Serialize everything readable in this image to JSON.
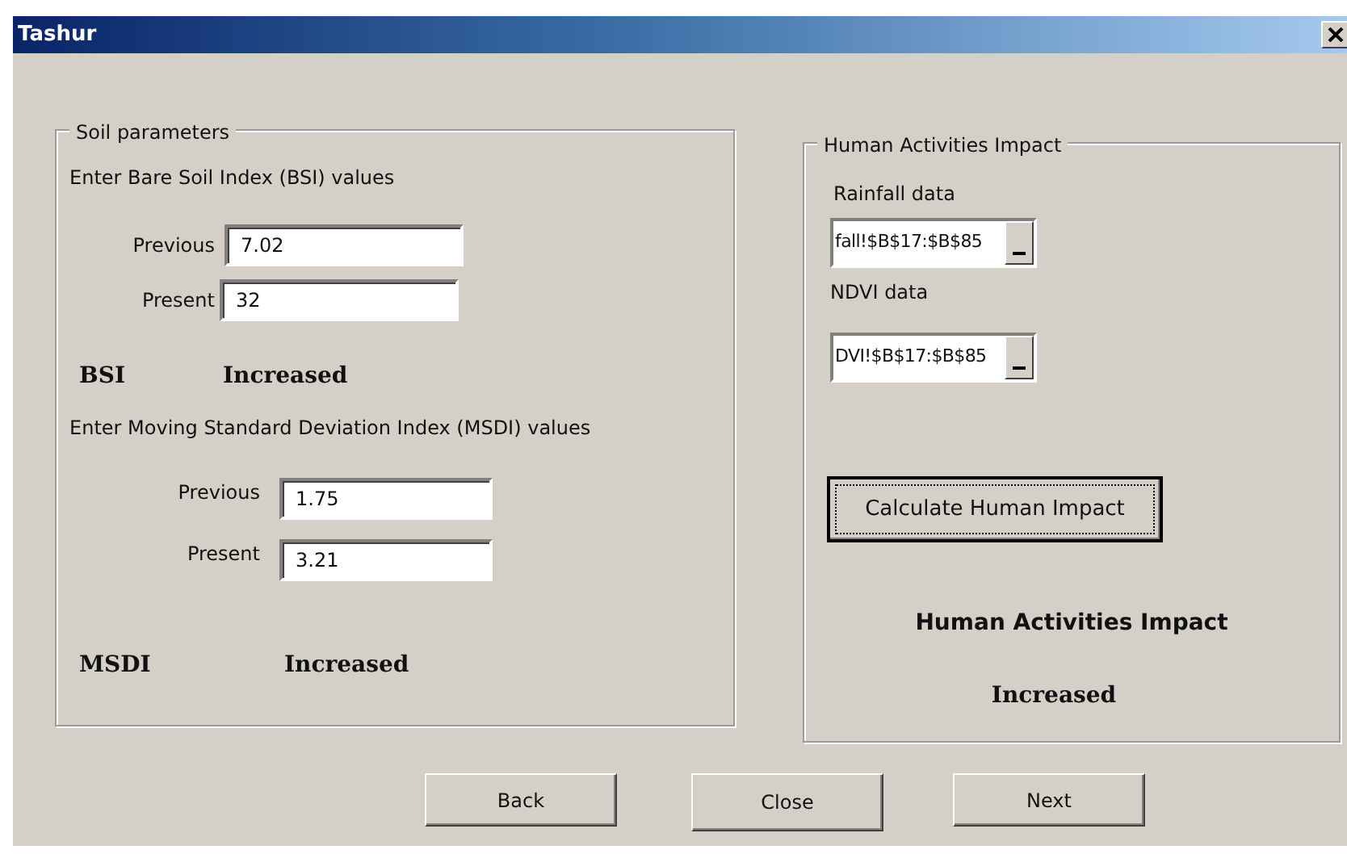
{
  "window": {
    "title": "Tashur"
  },
  "soil": {
    "legend": "Soil parameters",
    "groups": [
      {
        "prompt": "Enter Bare Soil Index (BSI) values",
        "fields": [
          {
            "label": "Previous",
            "value": "7.02"
          },
          {
            "label": "Present",
            "value": "32"
          }
        ],
        "name": "BSI",
        "result": "Increased"
      },
      {
        "prompt": "Enter Moving Standard Deviation Index (MSDI) values",
        "fields": [
          {
            "label": "Previous",
            "value": "1.75"
          },
          {
            "label": "Present",
            "value": "3.21"
          }
        ],
        "name": "MSDI",
        "result": "Increased"
      }
    ]
  },
  "human": {
    "legend": "Human Activities Impact",
    "inputs": [
      {
        "label": "Rainfall data",
        "value": "fall!$B$17:$B$85"
      },
      {
        "label": "NDVI data",
        "value": "DVI!$B$17:$B$85"
      }
    ],
    "button": "Calculate Human Impact",
    "result_title": "Human Activities Impact",
    "result": "Increased"
  },
  "buttons": [
    "Back",
    "Close",
    "Next"
  ]
}
